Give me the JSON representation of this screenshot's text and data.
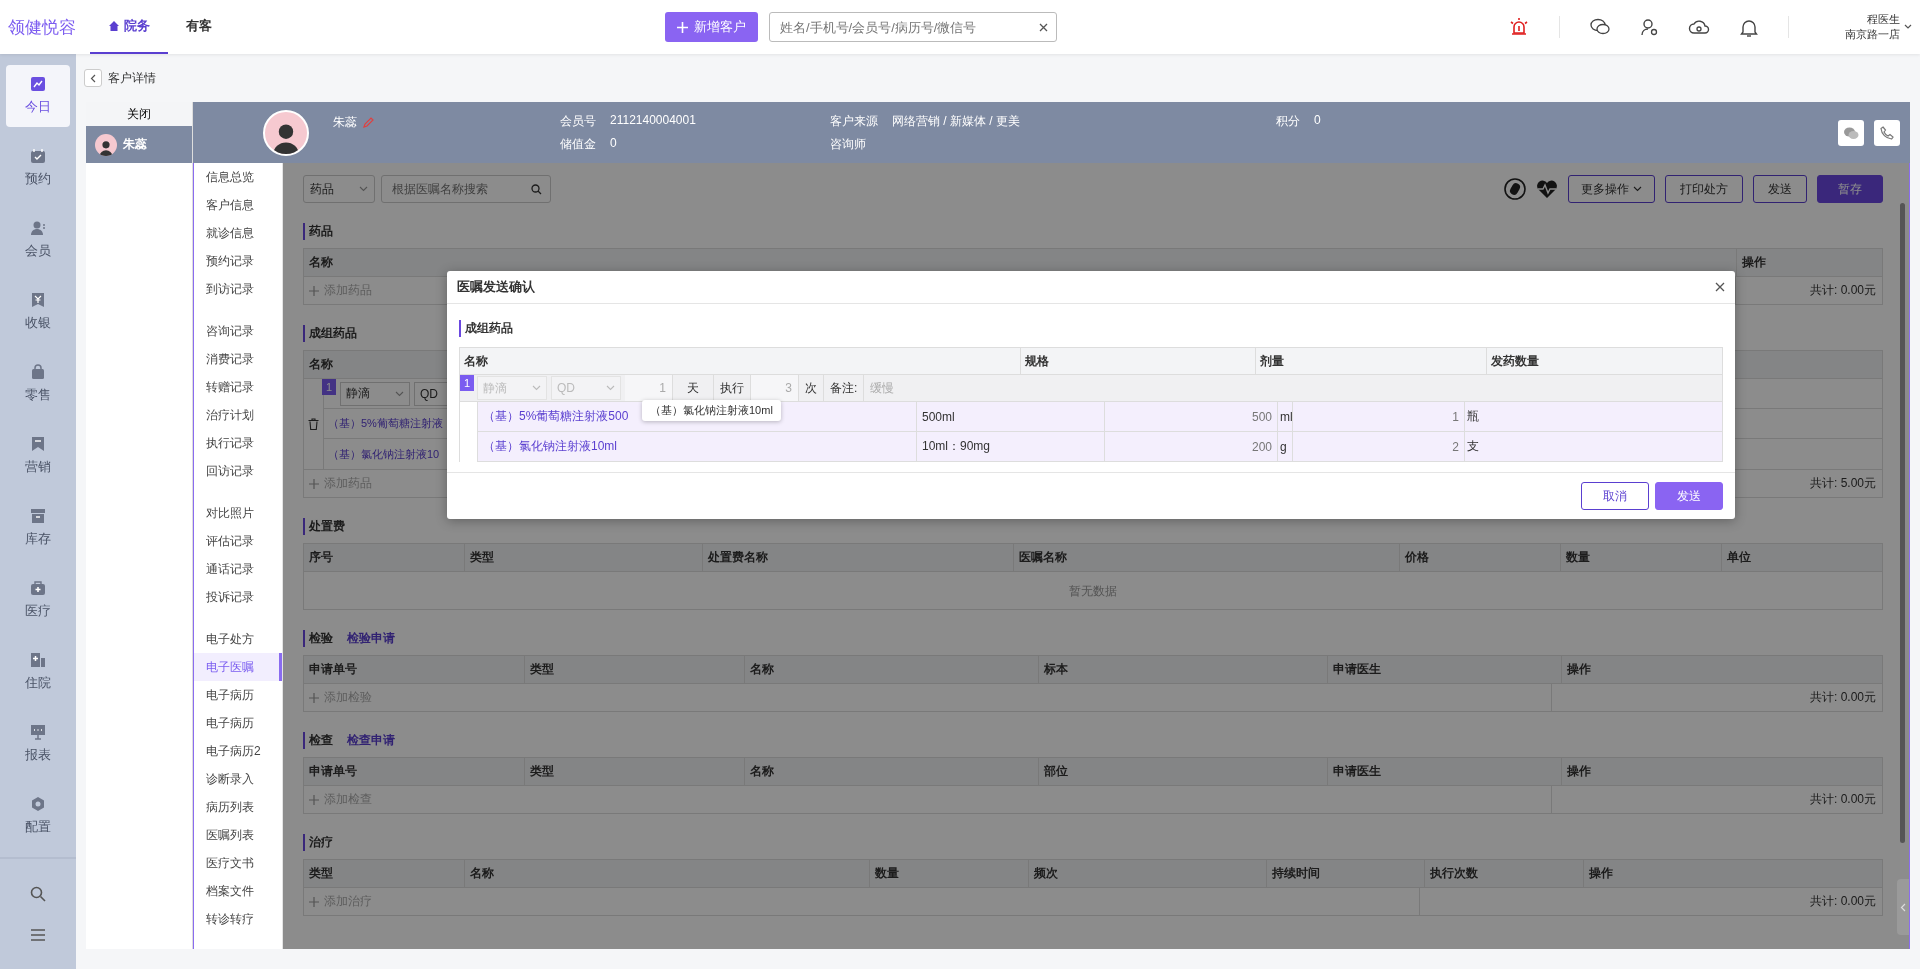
{
  "app": {
    "logo": "领健悦容"
  },
  "top_tabs": [
    {
      "label": "院务",
      "selected": true
    },
    {
      "label": "有客",
      "selected": false
    }
  ],
  "add_button": "新增客户",
  "search": {
    "placeholder": "姓名/手机号/会员号/病历号/微信号"
  },
  "user": {
    "name": "程医生",
    "store": "南京路一店"
  },
  "sidebar": {
    "items": [
      {
        "label": "今日",
        "selected": true
      },
      {
        "label": "预约",
        "selected": false
      },
      {
        "label": "会员",
        "selected": false
      },
      {
        "label": "收银",
        "selected": false
      },
      {
        "label": "零售",
        "selected": false
      },
      {
        "label": "营销",
        "selected": false
      },
      {
        "label": "库存",
        "selected": false
      },
      {
        "label": "医疗",
        "selected": false
      },
      {
        "label": "住院",
        "selected": false
      },
      {
        "label": "报表",
        "selected": false
      },
      {
        "label": "配置",
        "selected": false
      }
    ]
  },
  "breadcrumb": {
    "title": "客户详情"
  },
  "customer_tabs": {
    "close_label": "关闭",
    "items": [
      {
        "name": "朱蕊",
        "selected": true
      }
    ]
  },
  "customer": {
    "name": "朱蕊",
    "fields": [
      {
        "label": "会员号",
        "value": "2112140004001"
      },
      {
        "label": "客户来源",
        "value": "网络营销 / 新媒体 / 更美"
      },
      {
        "label": "积分",
        "value": "0"
      },
      {
        "label": "储值金",
        "value": "0"
      },
      {
        "label": "咨询师"
      }
    ]
  },
  "nav": {
    "groups": [
      [
        {
          "label": "信息总览",
          "selected": false
        },
        {
          "label": "客户信息",
          "selected": false
        },
        {
          "label": "就诊信息",
          "selected": false
        },
        {
          "label": "预约记录",
          "selected": false
        },
        {
          "label": "到访记录",
          "selected": false
        }
      ],
      [
        {
          "label": "咨询记录",
          "selected": false
        },
        {
          "label": "消费记录",
          "selected": false
        },
        {
          "label": "转赠记录",
          "selected": false
        },
        {
          "label": "治疗计划",
          "selected": false
        },
        {
          "label": "执行记录",
          "selected": false
        },
        {
          "label": "回访记录",
          "selected": false
        }
      ],
      [
        {
          "label": "对比照片",
          "selected": false
        },
        {
          "label": "评估记录",
          "selected": false
        },
        {
          "label": "通话记录",
          "selected": false
        },
        {
          "label": "投诉记录",
          "selected": false
        }
      ],
      [
        {
          "label": "电子处方",
          "selected": false
        },
        {
          "label": "电子医嘱",
          "selected": true
        },
        {
          "label": "电子病历",
          "selected": false
        },
        {
          "label": "电子病历",
          "selected": false
        },
        {
          "label": "电子病历2",
          "selected": false
        },
        {
          "label": "诊断录入",
          "selected": false
        },
        {
          "label": "病历列表",
          "selected": false
        },
        {
          "label": "医嘱列表",
          "selected": false
        },
        {
          "label": "医疗文书",
          "selected": false
        },
        {
          "label": "档案文件",
          "selected": false
        },
        {
          "label": "转诊转疗",
          "selected": false
        }
      ]
    ]
  },
  "toolbar": {
    "type_select": "药品",
    "search_placeholder": "根据医嘱名称搜索",
    "buttons": [
      {
        "label": "更多操作",
        "kind": "dropdown"
      },
      {
        "label": "打印处方",
        "kind": "outline"
      },
      {
        "label": "发送",
        "kind": "outline"
      },
      {
        "label": "暂存",
        "kind": "primary"
      }
    ]
  },
  "sections": [
    {
      "kind": "drug",
      "title": "药品",
      "columns": [
        "名称",
        "操作"
      ],
      "add_label": "添加药品",
      "total": "共计: 0.00元"
    },
    {
      "kind": "group",
      "title": "成组药品",
      "columns": [
        "名称"
      ],
      "group": {
        "index": "1",
        "route": "静滴",
        "frequency": "QD"
      },
      "rows": [
        "（基）5%葡萄糖注射液",
        "（基）氯化钠注射液10"
      ],
      "add_label": "添加药品",
      "total": "共计: 5.00元"
    },
    {
      "kind": "table",
      "title": "处置费",
      "columns": [
        "序号",
        "类型",
        "处置费名称",
        "医嘱名称",
        "价格",
        "数量",
        "单位"
      ],
      "empty": "暂无数据"
    },
    {
      "kind": "table",
      "title": "检验",
      "link": "检验申请",
      "columns": [
        "申请单号",
        "类型",
        "名称",
        "标本",
        "申请医生",
        "操作"
      ],
      "add_label": "添加检验",
      "total": "共计: 0.00元"
    },
    {
      "kind": "table",
      "title": "检查",
      "link": "检查申请",
      "columns": [
        "申请单号",
        "类型",
        "名称",
        "部位",
        "申请医生",
        "操作"
      ],
      "add_label": "添加检查",
      "total": "共计: 0.00元"
    },
    {
      "kind": "table",
      "title": "治疗",
      "columns": [
        "类型",
        "名称",
        "数量",
        "频次",
        "持续时间",
        "执行次数",
        "操作"
      ],
      "add_label": "添加治疗",
      "total": "共计: 0.00元"
    }
  ],
  "modal": {
    "title": "医嘱发送确认",
    "section": "成组药品",
    "columns": [
      "名称",
      "规格",
      "剂量",
      "发药数量"
    ],
    "group": {
      "index": "1",
      "route": "静滴",
      "frequency": "QD",
      "days": "1",
      "day_unit": "天",
      "exec_label": "执行",
      "times": "3",
      "times_unit": "次",
      "note_label": "备注:",
      "note": "缓慢",
      "disabled": true
    },
    "rows": [
      {
        "name": "（基）5%葡萄糖注射液500",
        "spec": "500ml",
        "dose": "500",
        "dose_unit": "ml",
        "qty": "1",
        "qty_unit": "瓶"
      },
      {
        "name": "（基）氯化钠注射液10ml",
        "spec": "10ml：90mg",
        "dose": "200",
        "dose_unit": "g",
        "qty": "2",
        "qty_unit": "支"
      }
    ],
    "tooltip": "（基）氯化钠注射液10ml",
    "buttons": [
      {
        "label": "取消",
        "kind": "outline"
      },
      {
        "label": "发送",
        "kind": "primary"
      }
    ]
  }
}
